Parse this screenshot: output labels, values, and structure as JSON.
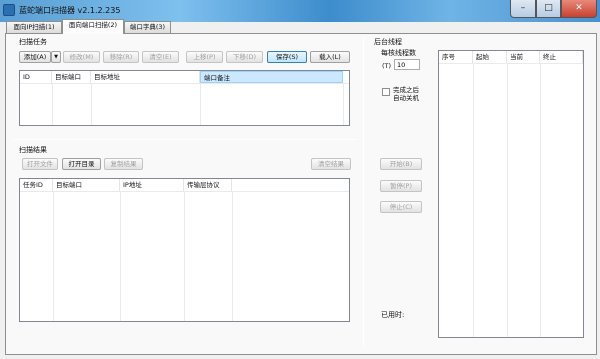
{
  "window": {
    "title": "蓝蛇端口扫描器 v2.1.2.235",
    "minimize": "–",
    "maximize": "□",
    "close": "✕"
  },
  "tabs": [
    {
      "label": "面向IP扫描(1)"
    },
    {
      "label": "面向端口扫描(2)"
    },
    {
      "label": "端口字典(3)"
    }
  ],
  "scan_tasks": {
    "section_label": "扫描任务",
    "toolbar": {
      "add": "添加(A)",
      "dropdown": "▼",
      "edit": "修改(M)",
      "remove": "移除(R)",
      "clear": "清空(E)",
      "move_up": "上移(P)",
      "move_down": "下移(D)",
      "save": "保存(S)",
      "load": "载入(L)"
    },
    "columns": [
      "ID",
      "目标端口",
      "目标地址",
      "端口备注"
    ]
  },
  "scan_results": {
    "section_label": "扫描结果",
    "toolbar": {
      "open_file": "打开文件",
      "open_dir": "打开目录",
      "copy_result": "复制结果",
      "clear_result": "清空结果"
    },
    "columns": [
      "任务ID",
      "目标端口",
      "IP地址",
      "传输层协议"
    ]
  },
  "background_threads": {
    "section_label": "后台线程",
    "per_core_label": "每核线程数",
    "t_label": "(T)",
    "thread_value": "10",
    "shutdown_label_1": "完成之后",
    "shutdown_label_2": "自动关机",
    "start": "开始(B)",
    "pause": "暂停(P)",
    "stop": "停止(C)",
    "elapsed_label": "已用时:",
    "columns": [
      "序号",
      "起始",
      "当前",
      "终止"
    ]
  }
}
